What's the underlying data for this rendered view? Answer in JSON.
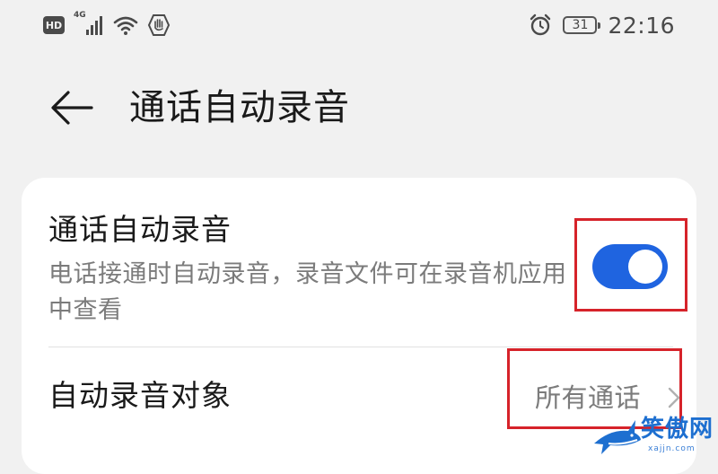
{
  "status_bar": {
    "hd_badge": "HD",
    "network_type": "4G",
    "battery_level": "31",
    "time": "22:16",
    "icons": [
      "hd-icon",
      "signal-icon",
      "wifi-icon",
      "hand-shield-icon",
      "alarm-icon",
      "battery-icon"
    ]
  },
  "header": {
    "title": "通话自动录音",
    "back_icon": "arrow-left-icon"
  },
  "settings": {
    "auto_record": {
      "title": "通话自动录音",
      "description": "电话接通时自动录音，录音文件可在录音机应用中查看",
      "enabled": true
    },
    "record_target": {
      "title": "自动录音对象",
      "value": "所有通话",
      "icon": "chevron-right-icon"
    }
  },
  "watermark": {
    "text": "笑傲网",
    "url": "xajjn.com"
  },
  "colors": {
    "background": "#f1f1f1",
    "card": "#ffffff",
    "accent": "#1f64e0",
    "highlight": "#d6232a",
    "primary_text": "#1a1a1a",
    "secondary_text": "#7b7b7b"
  }
}
